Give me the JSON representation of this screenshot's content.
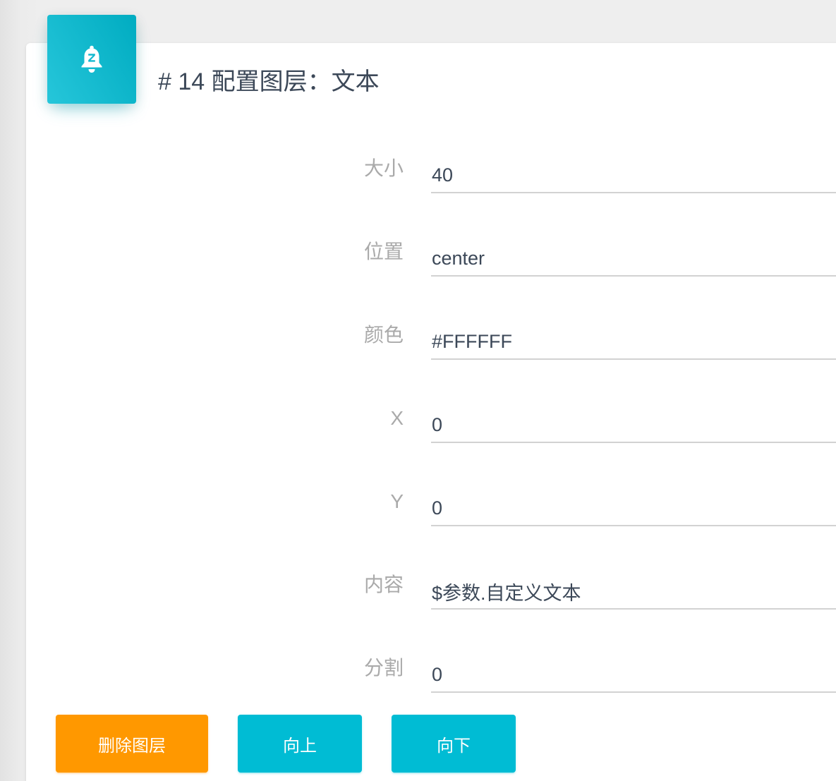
{
  "card": {
    "icon": "notifications-paused-icon",
    "title": "# 14 配置图层：文本"
  },
  "form": {
    "size_label": "大小",
    "size_value": "40",
    "position_label": "位置",
    "position_value": "center",
    "color_label": "颜色",
    "color_value": "#FFFFFF",
    "x_label": "X",
    "x_value": "0",
    "y_label": "Y",
    "y_value": "0",
    "content_label": "内容",
    "content_value": "$参数.自定义文本",
    "split_label": "分割",
    "split_value": "0"
  },
  "actions": {
    "delete_label": "删除图层",
    "up_label": "向上",
    "down_label": "向下"
  },
  "colors": {
    "accent": "#00bcd4",
    "warning": "#ff9800",
    "text": "#3c4858",
    "label": "#aaaaaa"
  }
}
